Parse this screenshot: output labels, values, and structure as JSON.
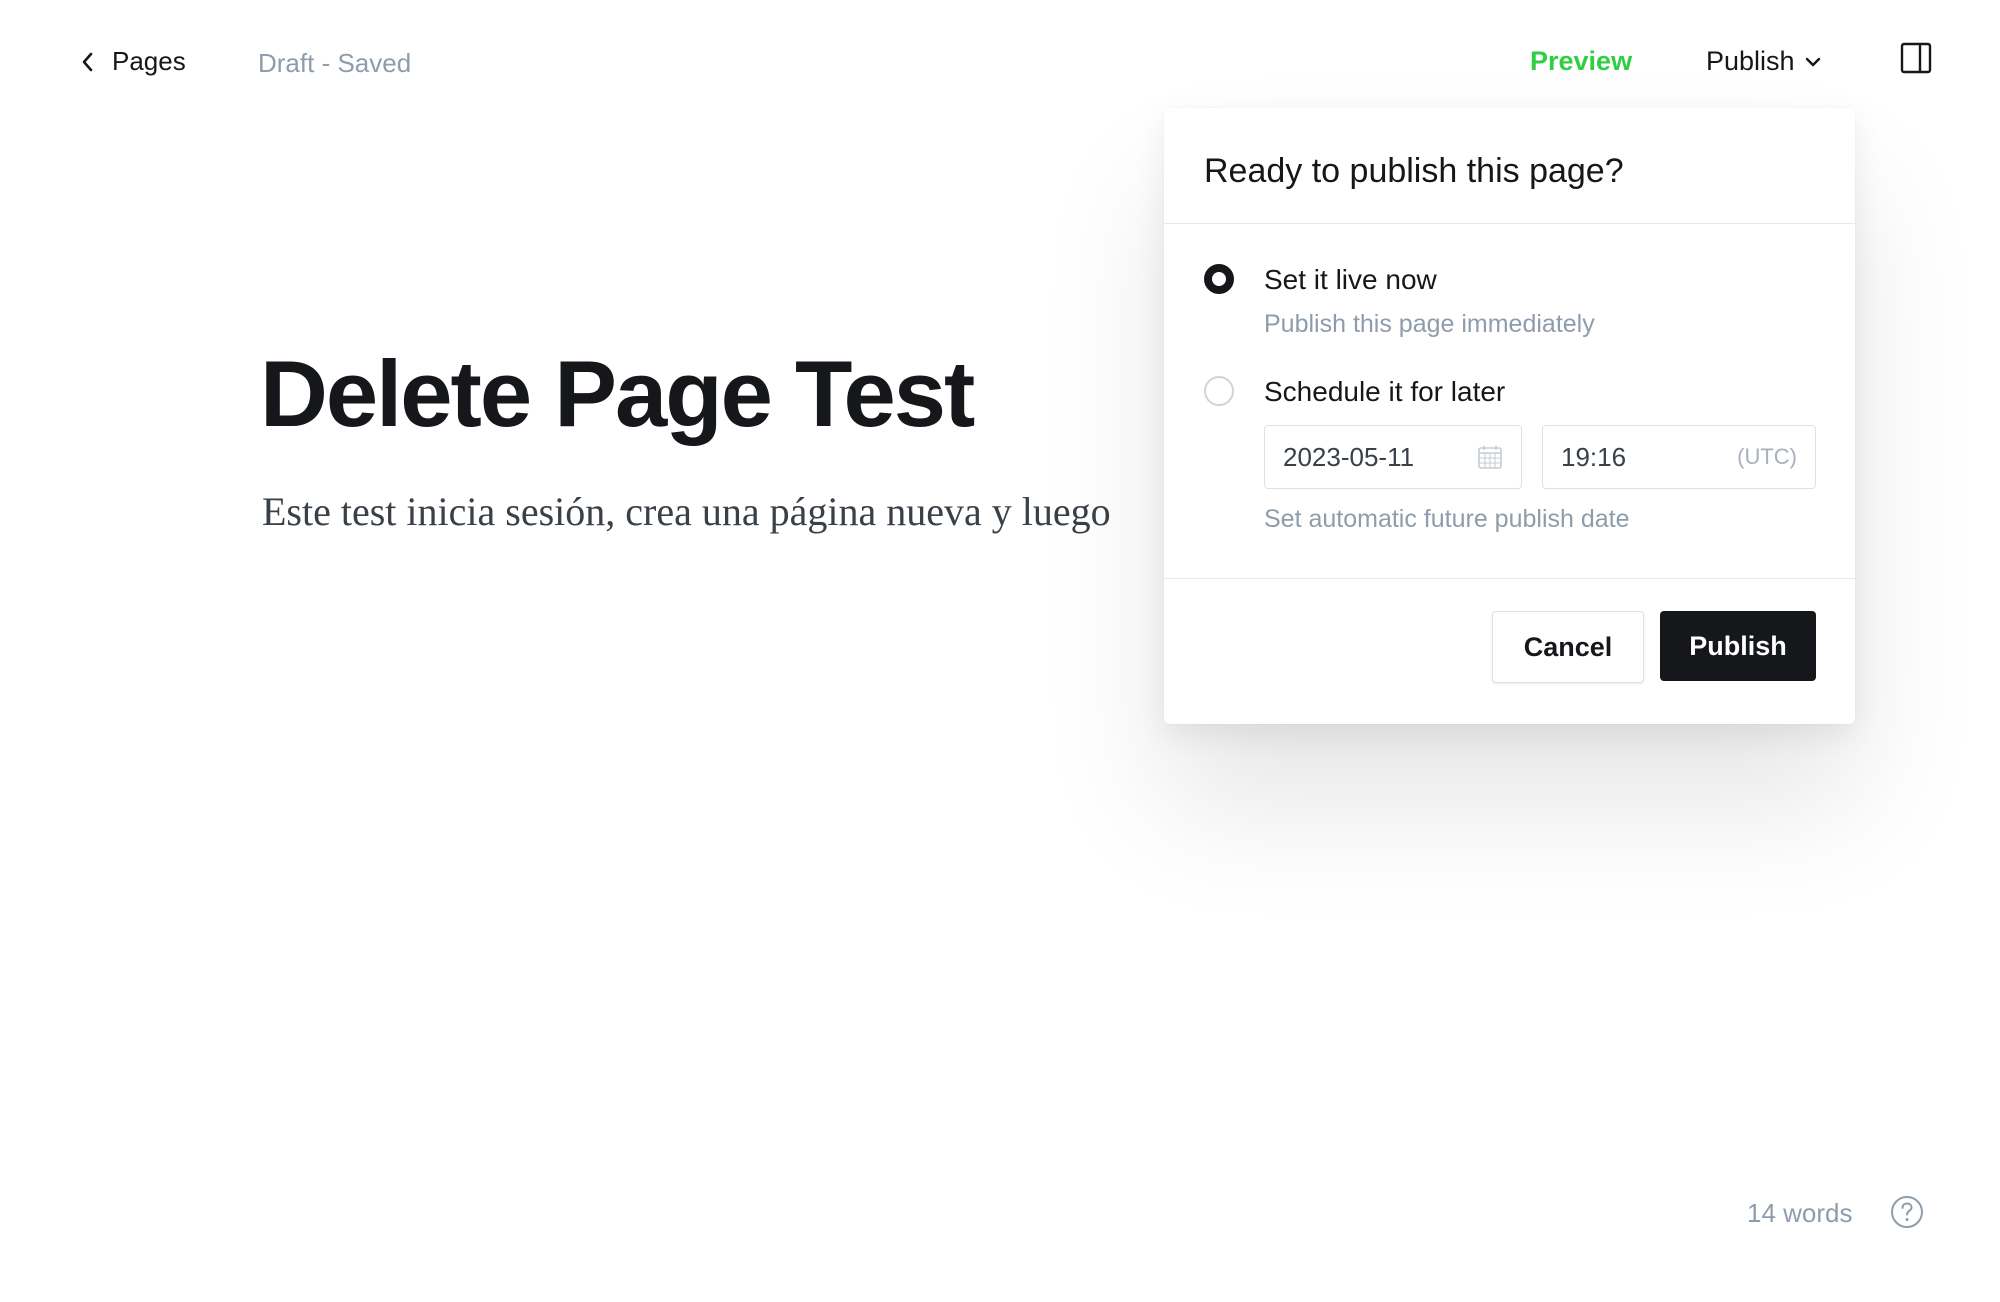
{
  "header": {
    "back_label": "Pages",
    "status": "Draft - Saved",
    "preview_label": "Preview",
    "publish_label": "Publish"
  },
  "editor": {
    "title": "Delete Page Test",
    "body": "Este test inicia sesión, crea una página nueva y luego"
  },
  "footer": {
    "word_count": "14 words"
  },
  "publish_popover": {
    "heading": "Ready to publish this page?",
    "options": [
      {
        "label": "Set it live now",
        "description": "Publish this page immediately",
        "selected": true
      },
      {
        "label": "Schedule it for later",
        "selected": false
      }
    ],
    "date_value": "2023-05-11",
    "time_value": "19:16",
    "timezone": "(UTC)",
    "schedule_hint": "Set automatic future publish date",
    "cancel_label": "Cancel",
    "confirm_label": "Publish"
  },
  "colors": {
    "accent_green": "#30cf43",
    "primary_dark": "#15171a",
    "muted_text": "#8e9cac"
  }
}
